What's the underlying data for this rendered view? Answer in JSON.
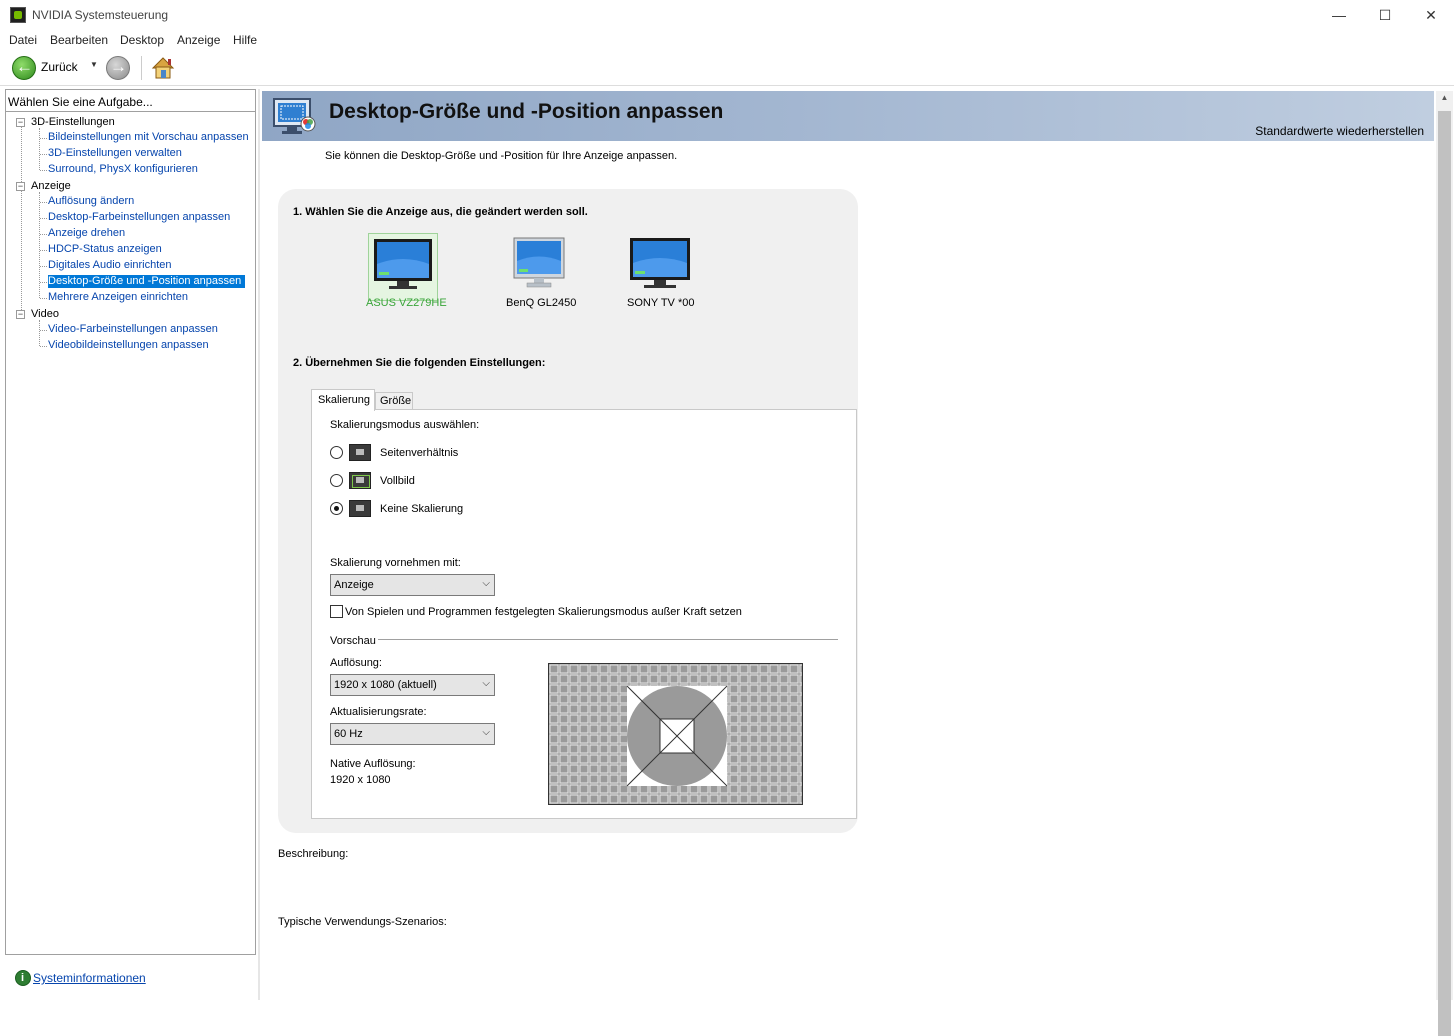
{
  "window": {
    "title": "NVIDIA Systemsteuerung",
    "minimize_glyph": "—",
    "maximize_glyph": "☐",
    "close_glyph": "✕"
  },
  "menu": [
    "Datei",
    "Bearbeiten",
    "Desktop",
    "Anzeige",
    "Hilfe"
  ],
  "toolbar": {
    "back_label": "Zurück",
    "dropdown_glyph": "▼"
  },
  "sidebar": {
    "header": "Wählen Sie eine Aufgabe...",
    "groups": [
      {
        "label": "3D-Einstellungen",
        "items": [
          "Bildeinstellungen mit Vorschau anpassen",
          "3D-Einstellungen verwalten",
          "Surround, PhysX konfigurieren"
        ]
      },
      {
        "label": "Anzeige",
        "items": [
          "Auflösung ändern",
          "Desktop-Farbeinstellungen anpassen",
          "Anzeige drehen",
          "HDCP-Status anzeigen",
          "Digitales Audio einrichten",
          "Desktop-Größe und -Position anpassen",
          "Mehrere Anzeigen einrichten"
        ]
      },
      {
        "label": "Video",
        "items": [
          "Video-Farbeinstellungen anpassen",
          "Videobildeinstellungen anpassen"
        ]
      }
    ],
    "toggle_glyph": "−",
    "footer_link": "Systeminformationen"
  },
  "page": {
    "title": "Desktop-Größe und -Position anpassen",
    "restore_defaults": "Standardwerte wiederherstellen",
    "intro": "Sie können die Desktop-Größe und -Position für Ihre Anzeige anpassen.",
    "step1": "1. Wählen Sie die Anzeige aus, die geändert werden soll.",
    "displays": [
      "ASUS VZ279HE",
      "BenQ GL2450",
      "SONY TV  *00"
    ],
    "step2": "2. Übernehmen Sie die folgenden Einstellungen:",
    "tabs": [
      "Skalierung",
      "Größe"
    ],
    "scaling_mode_label": "Skalierungsmodus auswählen:",
    "scaling_modes": [
      "Seitenverhältnis",
      "Vollbild",
      "Keine Skalierung"
    ],
    "scale_with_label": "Skalierung vornehmen mit:",
    "scale_with_value": "Anzeige",
    "override_checkbox": "Von Spielen und Programmen festgelegten Skalierungsmodus außer Kraft setzen",
    "preview_label": "Vorschau",
    "resolution_label": "Auflösung:",
    "resolution_value": "1920 x 1080 (aktuell)",
    "refresh_label": "Aktualisierungsrate:",
    "refresh_value": "60 Hz",
    "native_label": "Native Auflösung:",
    "native_value": "1920 x 1080",
    "description_label": "Beschreibung:",
    "usage_label": "Typische Verwendungs-Szenarios:",
    "chevron_glyph": "⌵"
  },
  "colors": {
    "selection": "#0078d7",
    "selected_display_text": "#3aa53a",
    "header_band": "#9fb3cf"
  }
}
